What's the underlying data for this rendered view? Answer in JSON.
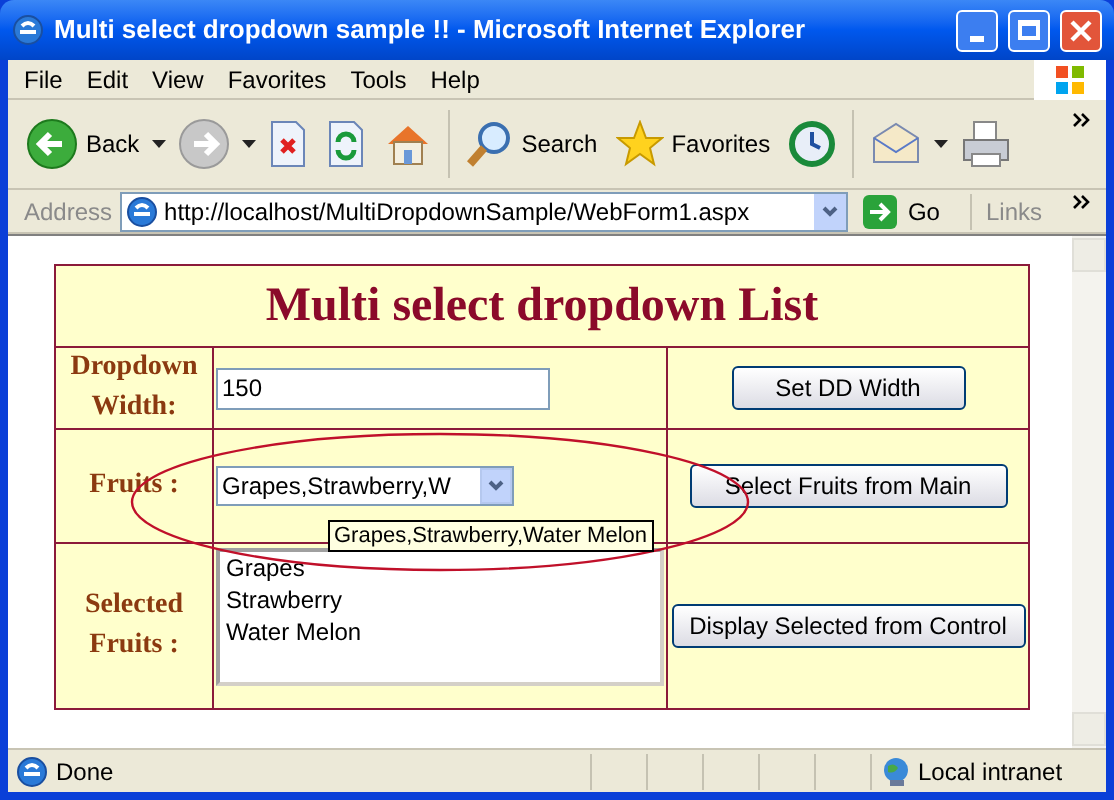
{
  "window": {
    "title": "Multi select dropdown sample !! - Microsoft Internet Explorer"
  },
  "menu": [
    {
      "label": "File"
    },
    {
      "label": "Edit"
    },
    {
      "label": "View"
    },
    {
      "label": "Favorites"
    },
    {
      "label": "Tools"
    },
    {
      "label": "Help"
    }
  ],
  "toolbar": [
    {
      "kind": "back",
      "label": "Back"
    },
    {
      "kind": "forward"
    },
    {
      "kind": "stop"
    },
    {
      "kind": "refresh"
    },
    {
      "kind": "home"
    },
    {
      "kind": "search",
      "label": "Search"
    },
    {
      "kind": "favorites",
      "label": "Favorites"
    },
    {
      "kind": "history"
    },
    {
      "kind": "mail"
    },
    {
      "kind": "print"
    }
  ],
  "address_bar": {
    "label": "Address",
    "url": "http://localhost/MultiDropdownSample/WebForm1.aspx",
    "go": "Go",
    "links": "Links"
  },
  "page": {
    "heading": "Multi select dropdown List",
    "rows": [
      {
        "kind": "textbox",
        "label": "Dropdown Width:",
        "value": "150",
        "button": "Set DD Width"
      },
      {
        "kind": "dropdown",
        "label": "Fruits :",
        "value": "Grapes,Strawberry,W",
        "tooltip": "Grapes,Strawberry,Water Melon",
        "button": "Select Fruits from Main"
      },
      {
        "kind": "listbox",
        "label": "Selected Fruits :",
        "items": [
          "Grapes",
          "Strawberry",
          "Water Melon"
        ],
        "button": "Display Selected from Control"
      }
    ]
  },
  "status_bar": {
    "text": "Done",
    "zone": "Local intranet"
  }
}
